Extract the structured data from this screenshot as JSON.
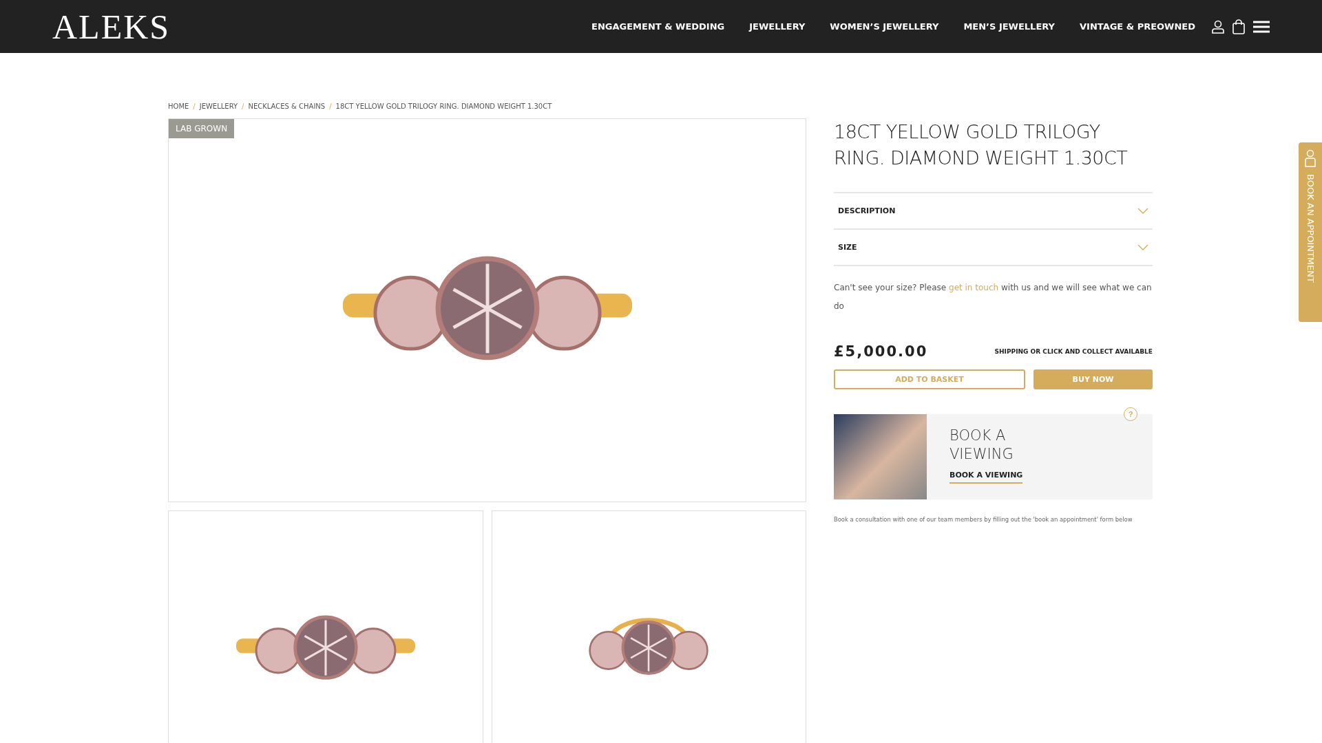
{
  "header": {
    "logo": "ALEKS",
    "nav": [
      {
        "label": "ENGAGEMENT & WEDDING"
      },
      {
        "label": "JEWELLERY"
      },
      {
        "label": "WOMEN’S JEWELLERY"
      },
      {
        "label": "MEN’S JEWELLERY"
      },
      {
        "label": "VINTAGE & PREOWNED"
      }
    ]
  },
  "breadcrumb": {
    "separator": "/",
    "items": [
      "HOME",
      "JEWELLERY",
      "NECKLACES & CHAINS",
      "18CT YELLOW GOLD TRILOGY RING. DIAMOND WEIGHT 1.30CT"
    ]
  },
  "gallery": {
    "badge": "LAB GROWN"
  },
  "product": {
    "title": "18CT YELLOW GOLD TRILOGY RING. DIAMOND WEIGHT 1.30CT",
    "accordion": [
      {
        "label": "DESCRIPTION",
        "expanded": false
      },
      {
        "label": "SIZE",
        "expanded": false
      }
    ],
    "size_note": {
      "before": "Can't see your size? Please",
      "link": "get in touch",
      "after": "with us and we will see what we can do"
    },
    "price": "£5,000.00",
    "shipping": "SHIPPING OR CLICK AND COLLECT AVAILABLE",
    "buttons": [
      {
        "label": "ADD TO BASKET",
        "kind": "outline"
      },
      {
        "label": "BUY NOW",
        "kind": "solid"
      }
    ],
    "viewing": {
      "help": "?",
      "title": "BOOK A VIEWING",
      "link": "BOOK A VIEWING"
    },
    "consultation": "Book a consultation with one of our team members by filling out the 'book an appointment' form below"
  },
  "side_tab": "BOOK AN APPOINTMENT"
}
